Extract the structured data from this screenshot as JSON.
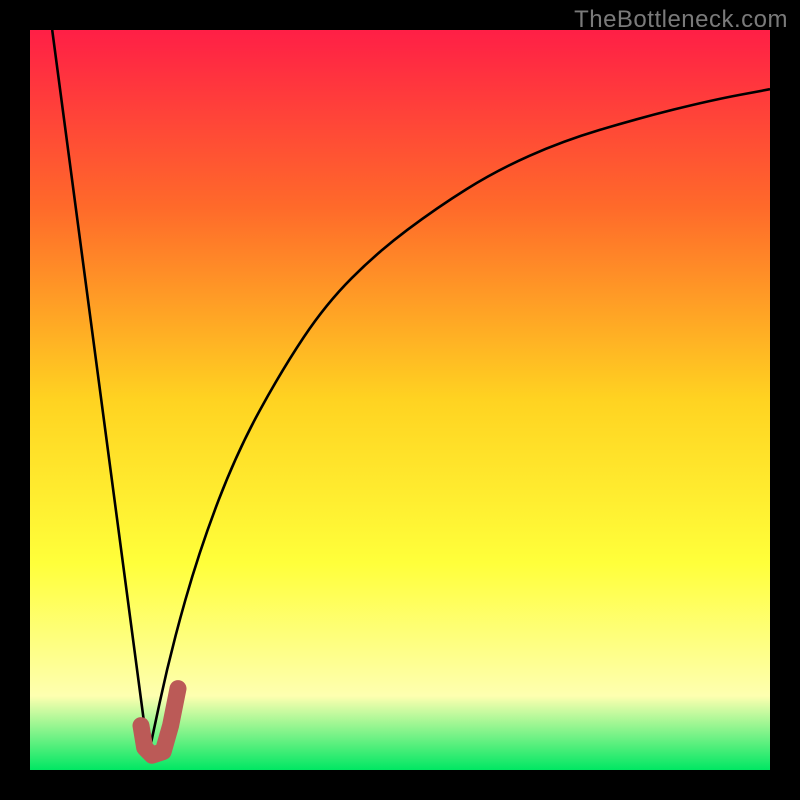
{
  "watermark": "TheBottleneck.com",
  "colors": {
    "frame": "#000000",
    "watermark": "#7a7a7a",
    "curve": "#000000",
    "marker_fill": "#bb5a57",
    "marker_stroke": "#bb5a57",
    "gradient_top": "#ff1f46",
    "gradient_mid1": "#ff6a2a",
    "gradient_mid2": "#ffd321",
    "gradient_mid3": "#ffff3a",
    "gradient_low_pale": "#feffb0",
    "gradient_bottom": "#00e763"
  },
  "chart_data": {
    "type": "line",
    "title": "",
    "xlabel": "",
    "ylabel": "",
    "xlim": [
      0,
      100
    ],
    "ylim": [
      0,
      100
    ],
    "series": [
      {
        "name": "left-branch",
        "x": [
          3,
          16
        ],
        "y": [
          100,
          2
        ]
      },
      {
        "name": "right-branch",
        "x": [
          16,
          19,
          23,
          28,
          34,
          40,
          47,
          55,
          63,
          72,
          82,
          92,
          100
        ],
        "y": [
          2,
          16,
          30,
          43,
          54,
          63,
          70,
          76,
          81,
          85,
          88,
          90.5,
          92
        ]
      }
    ],
    "marker": {
      "name": "optimal-marker",
      "path_xy": [
        [
          15,
          6
        ],
        [
          15.5,
          3
        ],
        [
          16.5,
          2
        ],
        [
          18,
          2.5
        ],
        [
          19,
          6
        ],
        [
          20,
          11
        ]
      ]
    }
  }
}
